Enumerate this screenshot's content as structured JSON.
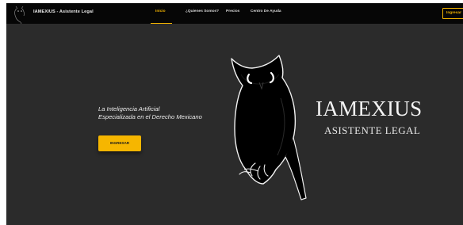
{
  "navbar": {
    "brand": "IAMEXIUS - Asistente Legal",
    "links": [
      {
        "label": "Inicio",
        "active": true
      },
      {
        "label": "¿Quienes Somos?",
        "active": false
      },
      {
        "label": "Precios",
        "active": false
      },
      {
        "label": "Centro De Ayuda",
        "active": false
      }
    ],
    "login_label": "Ingresar"
  },
  "hero": {
    "tagline_line1": "La Inteligencia Artificial",
    "tagline_line2": "Especializada en el Derecho Mexicano",
    "cta_label": "INGRESAR"
  },
  "logo": {
    "title": "IAMEXIUS",
    "subtitle": "ASISTENTE LEGAL",
    "icon": "owl-icon"
  },
  "colors": {
    "accent": "#f2b300",
    "background": "#2b2b2b",
    "navbar": "#060606",
    "text": "#ececec"
  }
}
